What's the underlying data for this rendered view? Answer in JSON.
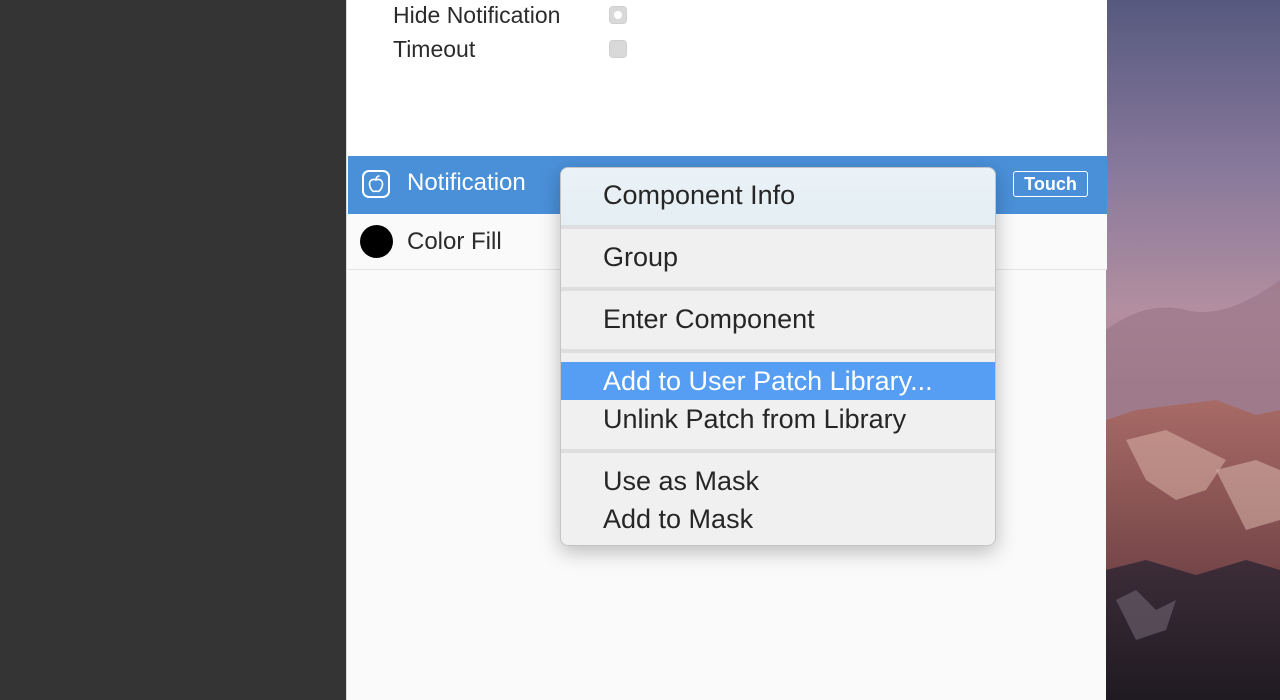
{
  "inspector": {
    "properties": [
      {
        "label": "Hide Notification",
        "checkbox": "dot"
      },
      {
        "label": "Timeout",
        "checkbox": "empty"
      }
    ]
  },
  "layers": {
    "selected": {
      "name": "Notification",
      "icon": "apple-logo-icon",
      "badge": "Touch"
    },
    "items": [
      {
        "name": "Color Fill",
        "swatch_color": "#000000"
      }
    ]
  },
  "context_menu": {
    "items": [
      {
        "label": "Component Info"
      },
      {
        "label": "Group"
      },
      {
        "label": "Enter Component"
      },
      {
        "label": "Add to User Patch Library...",
        "highlighted": true
      },
      {
        "label": "Unlink Patch from Library"
      },
      {
        "label": "Use as Mask"
      },
      {
        "label": "Add to Mask"
      }
    ]
  },
  "colors": {
    "selection_blue": "#4a90d9",
    "menu_highlight": "#569ef3",
    "dark_sidebar": "#343434"
  }
}
